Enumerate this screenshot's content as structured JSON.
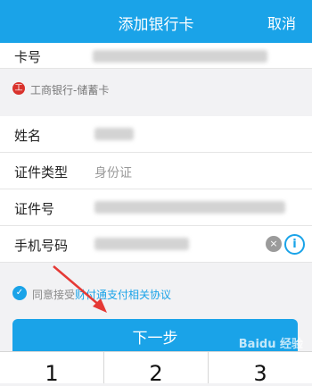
{
  "header": {
    "title": "添加银行卡",
    "cancel": "取消"
  },
  "card": {
    "label": "卡号"
  },
  "bank": {
    "logo_text": "工",
    "name": "工商银行-储蓄卡"
  },
  "form": {
    "name_label": "姓名",
    "id_type_label": "证件类型",
    "id_type_value": "身份证",
    "id_number_label": "证件号",
    "phone_label": "手机号码"
  },
  "icons": {
    "clear": "×",
    "info": "i",
    "check": "✓"
  },
  "agreement": {
    "prefix": "同意接受",
    "link": "财付通支付相关协议"
  },
  "next_button": "下一步",
  "keypad": [
    "1",
    "2",
    "3"
  ],
  "watermark": "Baidu 经验",
  "colors": {
    "accent": "#1aa3e8",
    "arrow": "#e53935"
  }
}
